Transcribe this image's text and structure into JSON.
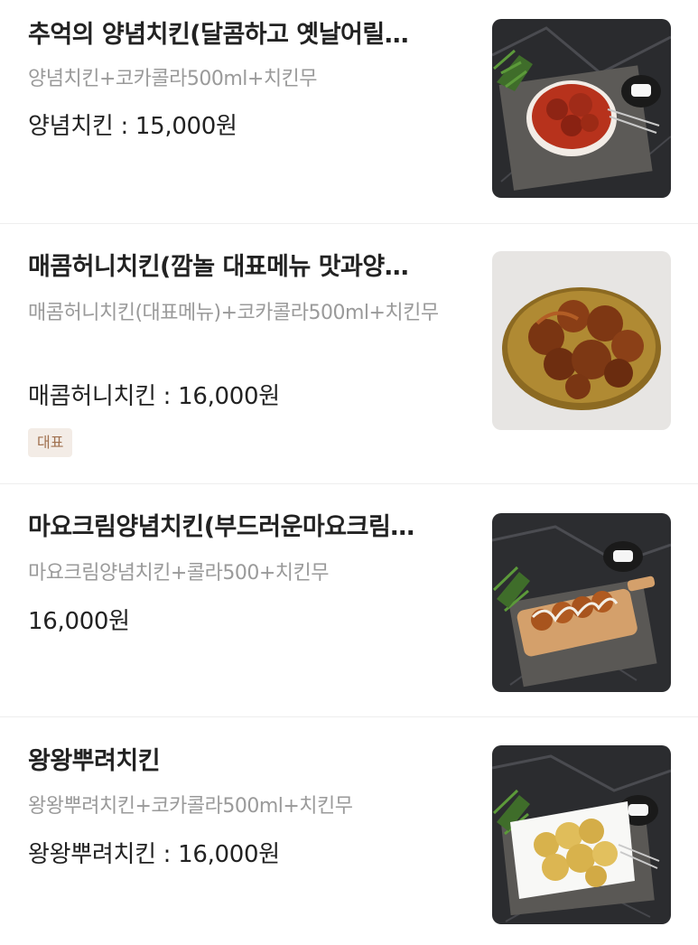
{
  "menu": {
    "items": [
      {
        "name": "추억의 양념치킨(달콤하고 옛날어릴…",
        "description": "양념치킨+코카콜라500ml+치킨무",
        "price": "양념치킨 : 15,000원",
        "image_alt": "seasoned-chicken-photo"
      },
      {
        "name": "매콤허니치킨(깜놀 대표메뉴 맛과양…",
        "description": "매콤허니치킨(대표메뉴)+코카콜라500ml+치킨무",
        "price": "매콤허니치킨 : 16,000원",
        "badge": "대표",
        "image_alt": "spicy-honey-chicken-photo"
      },
      {
        "name": "마요크림양념치킨(부드러운마요크림…",
        "description": "마요크림양념치킨+콜라500+치킨무",
        "price": "16,000원",
        "image_alt": "mayo-cream-chicken-photo"
      },
      {
        "name": "왕왕뿌려치킨",
        "description": "왕왕뿌려치킨+코카콜라500ml+치킨무",
        "price": "왕왕뿌려치킨 : 16,000원",
        "image_alt": "sprinkle-chicken-photo"
      }
    ]
  },
  "colors": {
    "title": "#222222",
    "description": "#9a9a9a",
    "badge_bg": "#f3ece6",
    "badge_text": "#a0704e",
    "divider": "#eeeeee"
  }
}
